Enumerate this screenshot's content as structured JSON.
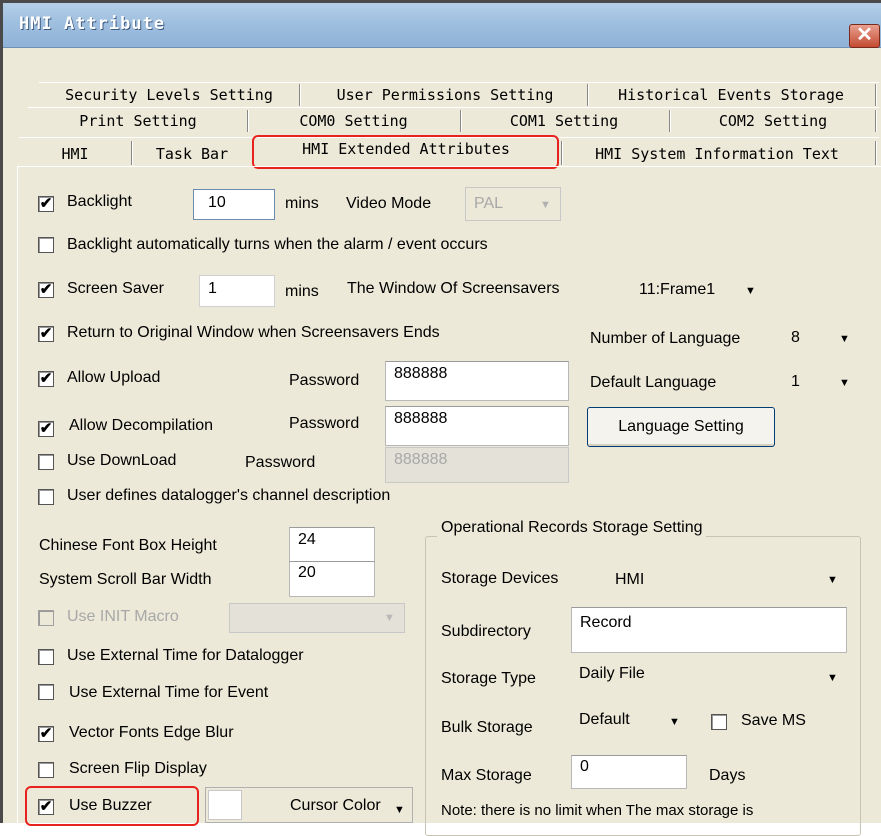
{
  "window": {
    "title": "HMI Attribute",
    "close_glyph": "✕"
  },
  "tabs": {
    "row1": [
      "Security Levels Setting",
      "User Permissions Setting",
      "Historical Events Storage"
    ],
    "row2": [
      "Print Setting",
      "COM0 Setting",
      "COM1 Setting",
      "COM2 Setting"
    ],
    "row3": [
      "HMI",
      "Task Bar",
      "HMI Extended Attributes",
      "HMI System Information Text"
    ]
  },
  "check": "✔",
  "left": {
    "backlight_label": "Backlight",
    "backlight_value": "10",
    "mins": "mins",
    "video_mode_label": "Video Mode",
    "video_mode_value": "PAL",
    "backlight_auto_label": "Backlight automatically turns when the alarm / event occurs",
    "screen_saver_label": "Screen Saver",
    "screen_saver_value": "1",
    "window_of_screensavers_label": "The Window Of Screensavers",
    "window_of_screensavers_value": "11:Frame1",
    "return_label": "Return to Original Window when Screensavers Ends",
    "allow_upload_label": "Allow Upload",
    "password_label": "Password",
    "upload_password": "888888",
    "allow_decompilation_label": "Allow Decompilation",
    "decompilation_password": "888888",
    "use_download_label": "Use DownLoad",
    "download_password": "888888",
    "user_defines_label": "User defines datalogger's channel description",
    "chinese_font_label": "Chinese Font Box Height",
    "chinese_font_value": "24",
    "scroll_bar_label": "System Scroll Bar Width",
    "scroll_bar_value": "20",
    "use_init_macro_label": "Use INIT Macro",
    "ext_time_datalogger_label": "Use External Time for Datalogger",
    "ext_time_event_label": "Use External Time for Event",
    "vector_fonts_label": "Vector Fonts Edge Blur",
    "screen_flip_label": "Screen Flip Display",
    "use_buzzer_label": "Use Buzzer",
    "cursor_color_label": "Cursor Color"
  },
  "right": {
    "num_language_label": "Number of Language",
    "num_language_value": "8",
    "default_language_label": "Default Language",
    "default_language_value": "1",
    "language_setting_button": "Language Setting"
  },
  "storage": {
    "group_title": "Operational Records Storage Setting",
    "devices_label": "Storage Devices",
    "devices_value": "HMI",
    "subdirectory_label": "Subdirectory",
    "subdirectory_value": "Record",
    "type_label": "Storage Type",
    "type_value": "Daily File",
    "bulk_label": "Bulk Storage",
    "bulk_value": "Default",
    "save_ms_label": "Save MS",
    "max_label": "Max Storage",
    "max_value": "0",
    "days_label": "Days",
    "note": "Note: there is no limit when The max storage is"
  },
  "arrow": "▼"
}
